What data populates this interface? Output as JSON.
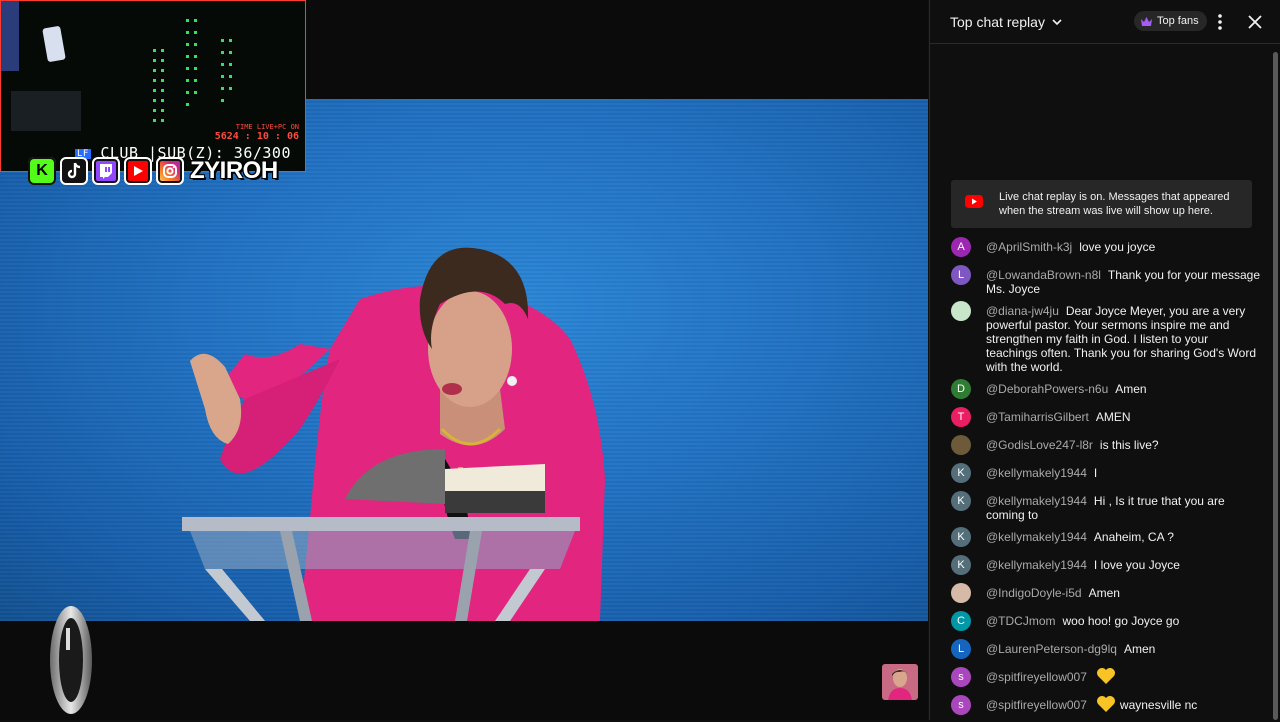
{
  "overlay": {
    "time_label": "TIME LIVE+PC ON",
    "time_value": "5624 : 10 : 06",
    "club_text": "CLUB |SUB(Z): 36/300",
    "club_badge": "LF",
    "social_icons": [
      "kick-icon",
      "tiktok-icon",
      "twitch-icon",
      "youtube-icon",
      "instagram-icon"
    ],
    "handle": "ZYIROH",
    "kick_letter": "K"
  },
  "chat": {
    "title": "Top chat replay",
    "top_fans_label": "Top fans",
    "banner_text": "Live chat replay is on. Messages that appeared when the stream was live will show up here.",
    "messages": [
      {
        "author": "@AprilSmith-k3j",
        "text": "love you joyce",
        "initial": "A",
        "color": "#9c27b0"
      },
      {
        "author": "@LowandaBrown-n8l",
        "text": "Thank you for your message Ms. Joyce",
        "initial": "L",
        "color": "#7e57c2"
      },
      {
        "author": "@diana-jw4ju",
        "text": "Dear Joyce Meyer, you are a very powerful pastor. Your sermons inspire me and strengthen my faith in God. I listen to your teachings often. Thank you for sharing God's Word with the world.",
        "initial": "",
        "color": "#c8e6c9"
      },
      {
        "author": "@DeborahPowers-n6u",
        "text": "Amen",
        "initial": "D",
        "color": "#2e7d32"
      },
      {
        "author": "@TamiharrisGilbert",
        "text": "AMEN",
        "initial": "T",
        "color": "#e91e63"
      },
      {
        "author": "@GodisLove247-l8r",
        "text": "is this live?",
        "initial": "",
        "color": "#6d5a3a"
      },
      {
        "author": "@kellymakely1944",
        "text": "I",
        "initial": "K",
        "color": "#546e7a"
      },
      {
        "author": "@kellymakely1944",
        "text": "Hi , Is it true that you are coming to",
        "initial": "K",
        "color": "#546e7a"
      },
      {
        "author": "@kellymakely1944",
        "text": "Anaheim, CA ?",
        "initial": "K",
        "color": "#546e7a"
      },
      {
        "author": "@kellymakely1944",
        "text": "I love you Joyce",
        "initial": "K",
        "color": "#546e7a"
      },
      {
        "author": "@IndigoDoyle-i5d",
        "text": "Amen",
        "initial": "",
        "color": "#d7b9a8"
      },
      {
        "author": "@TDCJmom",
        "text": "woo hoo! go Joyce go",
        "initial": "C",
        "color": "#0097a7"
      },
      {
        "author": "@LaurenPeterson-dg9lq",
        "text": "Amen",
        "initial": "L",
        "color": "#1565c0"
      },
      {
        "author": "@spitfireyellow007",
        "text": "",
        "initial": "s",
        "color": "#ab47bc",
        "heart": true
      },
      {
        "author": "@spitfireyellow007",
        "text": "waynesville nc",
        "initial": "s",
        "color": "#ab47bc",
        "heart": true
      }
    ]
  }
}
